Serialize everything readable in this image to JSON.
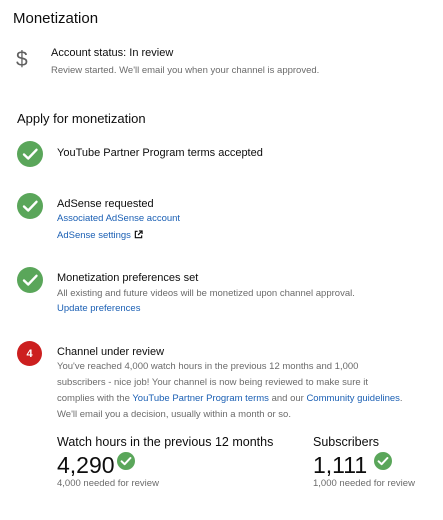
{
  "page": {
    "title": "Monetization"
  },
  "account": {
    "icon": "dollar-icon",
    "icon_glyph": "$",
    "status": "Account status: In review",
    "detail": "Review started. We'll email you when your channel is approved."
  },
  "apply": {
    "title": "Apply for monetization",
    "steps": [
      {
        "state": "done",
        "title": "YouTube Partner Program terms accepted"
      },
      {
        "state": "done",
        "title": "AdSense requested",
        "links": [
          "Associated AdSense account",
          "AdSense settings"
        ]
      },
      {
        "state": "done",
        "title": "Monetization preferences set",
        "subtitle": "All existing and future videos will be monetized upon channel approval.",
        "links": [
          "Update preferences"
        ]
      },
      {
        "state": "current",
        "number": "4",
        "title": "Channel under review",
        "desc_line1": "You've reached 4,000 watch hours in the previous 12 months and 1,000",
        "desc_line2": "subscribers - nice job! Your channel is now being reviewed to make sure it",
        "desc_line3_prefix": "complies with the ",
        "partner_terms_link": "YouTube Partner Program terms",
        "desc_line3_mid": " and our ",
        "guidelines_link": "Community guidelines",
        "desc_line3_suffix": ".",
        "desc_line4": "We'll email you a decision, usually within a month or so."
      }
    ]
  },
  "stats": {
    "watch_hours": {
      "label": "Watch hours in the previous 12 months",
      "value": "4,290",
      "requirement": "4,000 needed for review"
    },
    "subscribers": {
      "label": "Subscribers",
      "value": "1,111",
      "requirement": "1,000 needed for review"
    }
  },
  "colors": {
    "success": "#5aa65a",
    "current_step": "#cc1f1f",
    "link": "#1a5fb4",
    "muted": "#6b6b6b"
  }
}
